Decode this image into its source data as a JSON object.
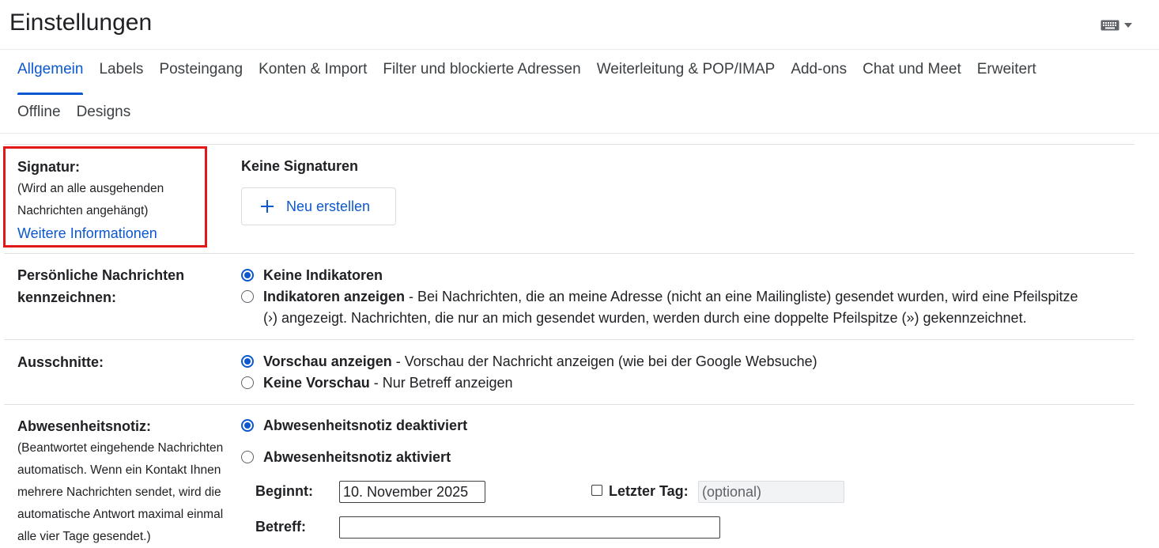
{
  "header": {
    "title": "Einstellungen",
    "keyboard_icon": "keyboard-icon"
  },
  "tabs_row1": [
    "Allgemein",
    "Labels",
    "Posteingang",
    "Konten & Import",
    "Filter und blockierte Adressen",
    "Weiterleitung & POP/IMAP",
    "Add-ons",
    "Chat und Meet",
    "Erweitert"
  ],
  "tabs_row2": [
    "Offline",
    "Designs"
  ],
  "active_tab": "Allgemein",
  "signature": {
    "label": "Signatur:",
    "desc_line1": "(Wird an alle ausgehenden",
    "desc_line2": "Nachrichten angehängt)",
    "link": "Weitere Informationen",
    "heading": "Keine Signaturen",
    "new_button": "Neu erstellen"
  },
  "personal": {
    "label_line1": "Persönliche Nachrichten",
    "label_line2": "kennzeichnen:",
    "opt1": "Keine Indikatoren",
    "opt2_bold": "Indikatoren anzeigen",
    "opt2_text_line1": " - Bei Nachrichten, die an meine Adresse (nicht an eine Mailingliste) gesendet wurden, wird eine Pfeilspitze",
    "opt2_text_line2": "(›) angezeigt. Nachrichten, die nur an mich gesendet wurden, werden durch eine doppelte Pfeilspitze (») gekennzeichnet."
  },
  "snippets": {
    "label": "Ausschnitte:",
    "opt1_bold": "Vorschau anzeigen",
    "opt1_text": " - Vorschau der Nachricht anzeigen (wie bei der Google Websuche)",
    "opt2_bold": "Keine Vorschau",
    "opt2_text": " - Nur Betreff anzeigen"
  },
  "vacation": {
    "label": "Abwesenheitsnotiz:",
    "desc_line1": "(Beantwortet eingehende Nachrichten",
    "desc_line2": "automatisch. Wenn ein Kontakt Ihnen",
    "desc_line3": "mehrere Nachrichten sendet, wird die",
    "desc_line4": "automatische Antwort maximal einmal",
    "desc_line5": "alle vier Tage gesendet.)",
    "opt1": "Abwesenheitsnotiz deaktiviert",
    "opt2": "Abwesenheitsnotiz aktiviert",
    "start_label": "Beginnt:",
    "start_value": "10. November 2025",
    "last_day_label": "Letzter Tag:",
    "last_day_placeholder": "(optional)",
    "subject_label": "Betreff:",
    "subject_value": ""
  },
  "colors": {
    "accent": "#0b57d0",
    "highlight": "#e01818"
  }
}
